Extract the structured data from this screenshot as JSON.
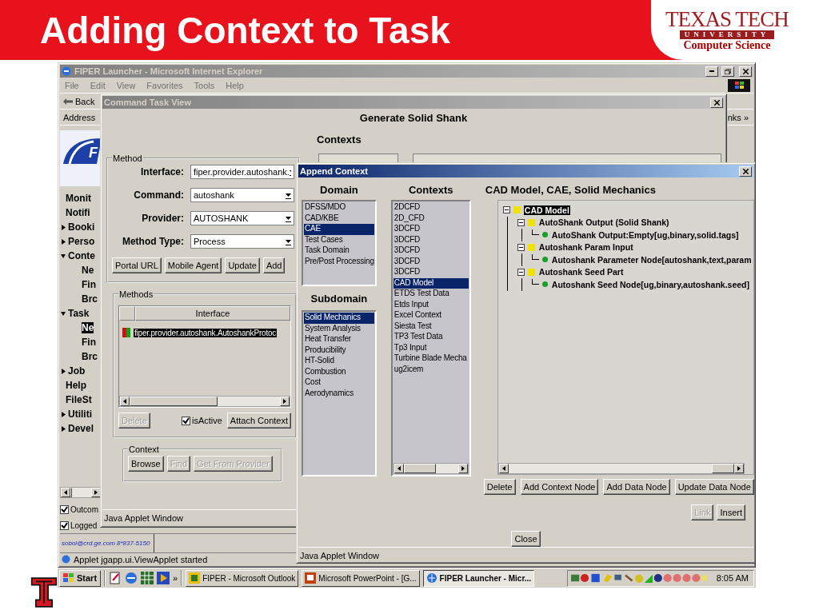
{
  "slide": {
    "title": "Adding Context to Task",
    "logo": {
      "line_1": "TEXAS TECH",
      "line_2": "UNIVERSITY",
      "line_3": "Computer Science"
    }
  },
  "browser": {
    "title": "FIPER Launcher - Microsoft Internet Explorer",
    "menu": [
      "File",
      "Edit",
      "View",
      "Favorites",
      "Tools",
      "Help"
    ],
    "back": "Back",
    "address_label": "Address",
    "links": "nks »",
    "logo_letter": "F",
    "nav": [
      {
        "label": "Monit",
        "kind": "link",
        "selected": false
      },
      {
        "label": "Notifi",
        "kind": "link",
        "selected": false
      },
      {
        "label": "Booki",
        "kind": "group",
        "expanded": false,
        "selected": false
      },
      {
        "label": "Perso",
        "kind": "group",
        "expanded": false,
        "selected": false
      },
      {
        "label": "Conte",
        "kind": "group",
        "expanded": true,
        "selected": false,
        "children": [
          {
            "label": "Ne",
            "selected": false
          },
          {
            "label": "Fin",
            "selected": false
          },
          {
            "label": "Brc",
            "selected": false
          }
        ]
      },
      {
        "label": "Task",
        "kind": "group",
        "expanded": true,
        "selected": false,
        "children": [
          {
            "label": "Ne",
            "selected": true
          },
          {
            "label": "Fin",
            "selected": false
          },
          {
            "label": "Brc",
            "selected": false
          }
        ]
      },
      {
        "label": "Job",
        "kind": "group",
        "expanded": false,
        "selected": false
      },
      {
        "label": "Help",
        "kind": "link",
        "selected": false
      },
      {
        "label": "FileSt",
        "kind": "link",
        "selected": false
      },
      {
        "label": "Utiliti",
        "kind": "group",
        "expanded": false,
        "selected": false
      },
      {
        "label": "Devel",
        "kind": "group",
        "expanded": false,
        "selected": false
      }
    ],
    "checkboxes": [
      {
        "label": "Outcom",
        "checked": true
      },
      {
        "label": "Logged",
        "checked": true
      }
    ],
    "contact": "sobol@crd.ge.com 8*837-5150",
    "status": "Applet jgapp.ui.ViewApplet started"
  },
  "command_window": {
    "title": "Command Task View",
    "heading": "Generate Solid Shank",
    "contexts_heading": "Contexts",
    "method": {
      "legend": "Method",
      "fields": [
        {
          "label": "Interface:",
          "value": "fiper.provider.autoshank."
        },
        {
          "label": "Command:",
          "value": "autoshank"
        },
        {
          "label": "Provider:",
          "value": "AUTOSHANK"
        },
        {
          "label": "Method Type:",
          "value": "Process"
        }
      ],
      "buttons": [
        {
          "label": "Portal URL",
          "disabled": false
        },
        {
          "label": "Mobile Agent",
          "disabled": false
        },
        {
          "label": "Update",
          "disabled": false
        },
        {
          "label": "Add",
          "disabled": false
        }
      ]
    },
    "methods": {
      "legend": "Methods",
      "columns": [
        "Interface"
      ],
      "rows": [
        {
          "interface": "fiper.provider.autoshank.AutoshankProtoc",
          "selected": true
        }
      ],
      "delete": {
        "label": "Delete",
        "disabled": true
      },
      "is_active": {
        "label": "isActive",
        "checked": true
      },
      "attach": {
        "label": "Attach Context",
        "disabled": false
      }
    },
    "context": {
      "legend": "Context",
      "buttons": [
        {
          "label": "Browse",
          "disabled": false
        },
        {
          "label": "Find",
          "disabled": true
        },
        {
          "label": "Get From Provider",
          "disabled": true
        }
      ]
    },
    "footer": "Java Applet Window"
  },
  "append_window": {
    "title": "Append Context",
    "domain_heading": "Domain",
    "domains": [
      {
        "label": "DFSS/MDO",
        "selected": false
      },
      {
        "label": "CAD/KBE",
        "selected": false
      },
      {
        "label": "CAE",
        "selected": true
      },
      {
        "label": "Test Cases",
        "selected": false
      },
      {
        "label": "Task Domain",
        "selected": false
      },
      {
        "label": "Pre/Post Processing",
        "selected": false
      }
    ],
    "subdomain_heading": "Subdomain",
    "subdomains": [
      {
        "label": "Solid Mechanics",
        "selected": true
      },
      {
        "label": "System Analysis",
        "selected": false
      },
      {
        "label": "Heat Transfer",
        "selected": false
      },
      {
        "label": "Producibility",
        "selected": false
      },
      {
        "label": "HT-Solid",
        "selected": false
      },
      {
        "label": "Combustion",
        "selected": false
      },
      {
        "label": "Cost",
        "selected": false
      },
      {
        "label": "Aerodynamics",
        "selected": false
      }
    ],
    "contexts_heading": "Contexts",
    "contexts": [
      {
        "label": "2DCFD",
        "selected": false
      },
      {
        "label": "2D_CFD",
        "selected": false
      },
      {
        "label": "3DCFD",
        "selected": false
      },
      {
        "label": "3DCFD",
        "selected": false
      },
      {
        "label": "3DCFD",
        "selected": false
      },
      {
        "label": "3DCFD",
        "selected": false
      },
      {
        "label": "3DCFD",
        "selected": false
      },
      {
        "label": "CAD Model",
        "selected": true
      },
      {
        "label": "ETDS Test Data",
        "selected": false
      },
      {
        "label": "Etds Input",
        "selected": false
      },
      {
        "label": "Excel Context",
        "selected": false
      },
      {
        "label": "Siesta Test",
        "selected": false
      },
      {
        "label": "TP3 Test Data",
        "selected": false
      },
      {
        "label": "Tp3 Input",
        "selected": false
      },
      {
        "label": "Turbine Blade Mecha",
        "selected": false
      },
      {
        "label": "ug2icem",
        "selected": false
      }
    ],
    "tree_heading": "CAD Model, CAE, Solid Mechanics",
    "tree": [
      {
        "label": "CAD Model",
        "kind": "context",
        "expanded": true,
        "selected": true,
        "children": [
          {
            "label": "AutoShank Output (Solid Shank)",
            "kind": "context",
            "expanded": true,
            "selected": false,
            "children": [
              {
                "label": "AutoShank Output:Empty[ug,binary,solid.tags]",
                "kind": "data",
                "selected": false
              }
            ]
          },
          {
            "label": "Autoshank Param Input",
            "kind": "context",
            "expanded": true,
            "selected": false,
            "children": [
              {
                "label": "Autoshank Parameter Node[autoshank,text,param",
                "kind": "data",
                "selected": false
              }
            ]
          },
          {
            "label": "Autoshank Seed Part",
            "kind": "context",
            "expanded": true,
            "selected": false,
            "children": [
              {
                "label": "Autoshank Seed Node[ug,binary,autoshank.seed]",
                "kind": "data",
                "selected": false
              }
            ]
          }
        ]
      }
    ],
    "tree_buttons": [
      {
        "label": "Delete",
        "disabled": false
      },
      {
        "label": "Add Context Node",
        "disabled": false
      },
      {
        "label": "Add Data Node",
        "disabled": false
      },
      {
        "label": "Update Data Node",
        "disabled": false
      }
    ],
    "link_buttons": [
      {
        "label": "Link",
        "disabled": true
      },
      {
        "label": "Insert",
        "disabled": false
      }
    ],
    "close": {
      "label": "Close",
      "disabled": false
    },
    "footer": "Java Applet Window"
  },
  "taskbar": {
    "start": "Start",
    "more": "»",
    "tasks": [
      {
        "label": "FIPER - Microsoft Outlook",
        "kind": "mail",
        "selected": false
      },
      {
        "label": "Microsoft PowerPoint - [G...",
        "kind": "slides",
        "selected": false
      },
      {
        "label": "FIPER Launcher - Micr...",
        "kind": "browser",
        "selected": true
      }
    ],
    "clock": "8:05 AM"
  }
}
